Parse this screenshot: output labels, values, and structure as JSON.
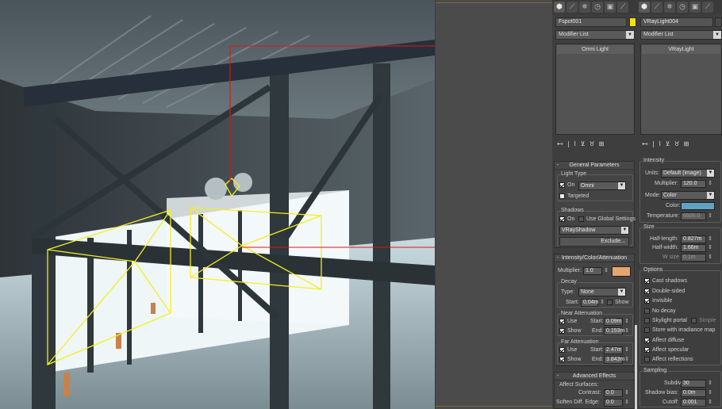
{
  "left": {
    "name": "Fspot001",
    "color": "#f2e21a",
    "modifier_list": "Modifier List",
    "stack_item": "Omni Light",
    "toolbar": [
      "⬢",
      "⟋",
      "⛯",
      "◷",
      "▣",
      "⟋"
    ],
    "stack_tools": [
      "⊷",
      "|",
      "⌇",
      "⊻",
      "♉",
      "⊞"
    ],
    "general": {
      "title": "General Parameters",
      "pm": "-",
      "light_type_label": "Light Type",
      "on": "On",
      "type_value": "Omni",
      "targeted": "Targeted",
      "shadows_label": "Shadows",
      "shadows_on": "On",
      "use_global": "Use Global Settings",
      "shadow_type": "VRayShadow",
      "exclude": "Exclude..."
    },
    "ica": {
      "title": "Intensity/Color/Attenuation",
      "pm": "-",
      "multiplier_label": "Multiplier:",
      "multiplier": "1.0",
      "color": "#e6a56d",
      "decay_label": "Decay",
      "type_label": "Type:",
      "type_value": "None",
      "start_label": "Start:",
      "start_value": "0.04m",
      "show": "Show",
      "near_label": "Near Attenuation",
      "use": "Use",
      "near_start_label": "Start:",
      "near_start": "0.09m",
      "near_show": "Show",
      "near_end_label": "End:",
      "near_end": "0.153m",
      "far_label": "Far Attenuation",
      "far_use": "Use",
      "far_start_label": "Start:",
      "far_start": "2.47m",
      "far_show": "Show",
      "far_end_label": "End:",
      "far_end": "3.843m"
    },
    "advanced": {
      "title": "Advanced Effects",
      "pm": "-",
      "affect_surfaces": "Affect Surfaces:",
      "contrast_label": "Contrast:",
      "contrast": "0.0",
      "soften_label": "Soften Diff. Edge:",
      "soften": "0.0"
    }
  },
  "right": {
    "name": "VRayLight004",
    "color": "#4a4a4a",
    "modifier_list": "Modifier List",
    "stack_item": "VRayLight",
    "toolbar": [
      "⬢",
      "⟋",
      "⛯",
      "◷",
      "▣",
      "⟋"
    ],
    "stack_tools": [
      "⊷",
      "|",
      "⌇",
      "⊻",
      "♉",
      "⊞"
    ],
    "intensity": {
      "title": "Intensity",
      "units_label": "Units:",
      "units_value": "Default (image)",
      "multiplier_label": "Multiplier:",
      "multiplier": "120.0",
      "mode_label": "Mode:",
      "mode_value": "Color",
      "color_label": "Color:",
      "color": "#5fa3c4",
      "temperature_label": "Temperature:",
      "temperature": "6500.0"
    },
    "size": {
      "title": "Size",
      "half_length_label": "Half-length:",
      "half_length": "0.827m",
      "half_width_label": "Half-width:",
      "half_width": "1.66m",
      "w_size_label": "W size",
      "w_size": "0.1m"
    },
    "options": {
      "title": "Options",
      "items": [
        "Cast shadows",
        "Double-sided",
        "Invisible",
        "No decay",
        "Skylight portal",
        "Store with irradiance map",
        "Affect diffuse",
        "Affect specular",
        "Affect reflections"
      ],
      "simple": "Simple"
    },
    "sampling": {
      "title": "Sampling",
      "subdivs_label": "Subdivs:",
      "subdivs": "30",
      "shadow_bias_label": "Shadow bias:",
      "shadow_bias": "0.0m",
      "cutoff_label": "Cutoff:",
      "cutoff": "0.001"
    }
  }
}
